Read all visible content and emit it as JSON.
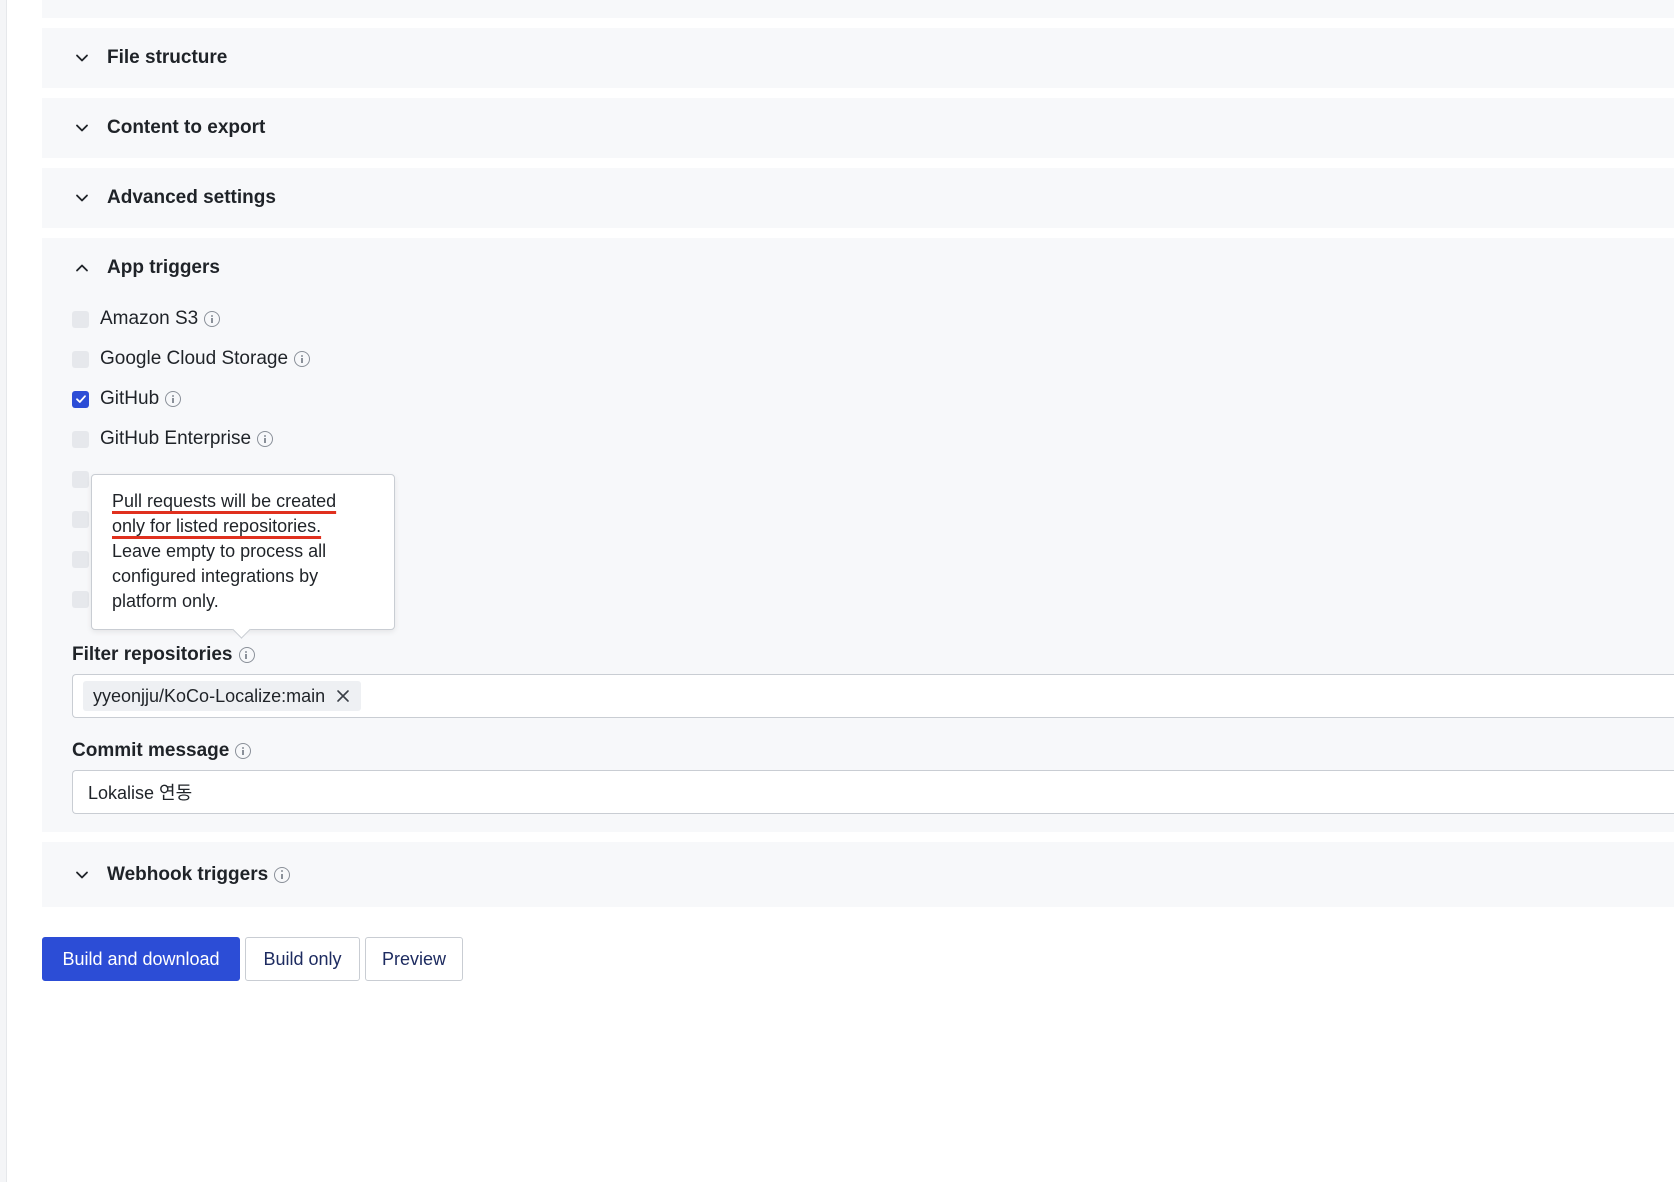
{
  "sections": {
    "file_structure": "File structure",
    "content_to_export": "Content to export",
    "advanced_settings": "Advanced settings",
    "app_triggers": "App triggers",
    "webhook_triggers": "Webhook triggers"
  },
  "app_triggers": {
    "items": [
      {
        "label": "Amazon S3",
        "checked": false
      },
      {
        "label": "Google Cloud Storage",
        "checked": false
      },
      {
        "label": "GitHub",
        "checked": true
      },
      {
        "label": "GitHub Enterprise",
        "checked": false
      }
    ],
    "filter_repositories": {
      "label": "Filter repositories",
      "chip": "yyeonjju/KoCo-Localize:main"
    },
    "commit_message": {
      "label": "Commit message",
      "value": "Lokalise 연동"
    }
  },
  "tooltip": {
    "line1": "Pull requests will be created",
    "line2": "only for listed repositories.",
    "rest": "Leave empty to process all configured integrations by platform only."
  },
  "buttons": {
    "build_and_download": "Build and download",
    "build_only": "Build only",
    "preview": "Preview"
  },
  "colors": {
    "accent": "#2c4dd6",
    "panel_bg": "#f7f8fa",
    "annotation_underline": "#e0301e"
  }
}
